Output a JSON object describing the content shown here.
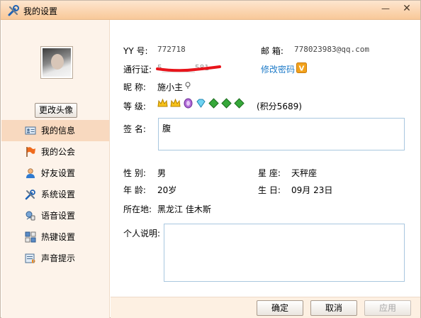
{
  "window": {
    "title": "我的设置"
  },
  "sidebar": {
    "change_avatar": "更改头像",
    "items": [
      {
        "label": "我的信息",
        "icon": "card-icon",
        "active": true
      },
      {
        "label": "我的公会",
        "icon": "flag-icon"
      },
      {
        "label": "好友设置",
        "icon": "user-icon"
      },
      {
        "label": "系统设置",
        "icon": "tools-icon"
      },
      {
        "label": "语音设置",
        "icon": "voice-icon"
      },
      {
        "label": "热键设置",
        "icon": "keyboard-icon"
      },
      {
        "label": "声音提示",
        "icon": "sound-icon"
      }
    ]
  },
  "info": {
    "yy_label": "YY  号:",
    "yy_value": "772718",
    "email_label": "邮  箱:",
    "email_value": "778023983@qq.com",
    "passport_label": "通行证:",
    "passport_value": "5_______581",
    "change_password": "修改密码",
    "nickname_label": "昵  称:",
    "nickname_value": "施小主",
    "level_label": "等  级:",
    "points": "(积分5689)",
    "signature_label": "签  名:",
    "signature_value": "腹",
    "gender_label": "性  别:",
    "gender_value": "男",
    "zodiac_label": "星  座:",
    "zodiac_value": "天秤座",
    "age_label": "年  龄:",
    "age_value": "20岁",
    "birthday_label": "生  日:",
    "birthday_value": "09月  23日",
    "location_label": "所在地:",
    "location_value": "黑龙江  佳木斯",
    "bio_label": "个人说明:",
    "bio_value": ""
  },
  "buttons": {
    "ok": "确定",
    "cancel": "取消",
    "apply": "应用"
  },
  "colors": {
    "accent": "#1e7bc8",
    "titlebar": "#fbd5b1",
    "sidebar_active": "#f8d9bf",
    "redaction": "#e8141b"
  }
}
